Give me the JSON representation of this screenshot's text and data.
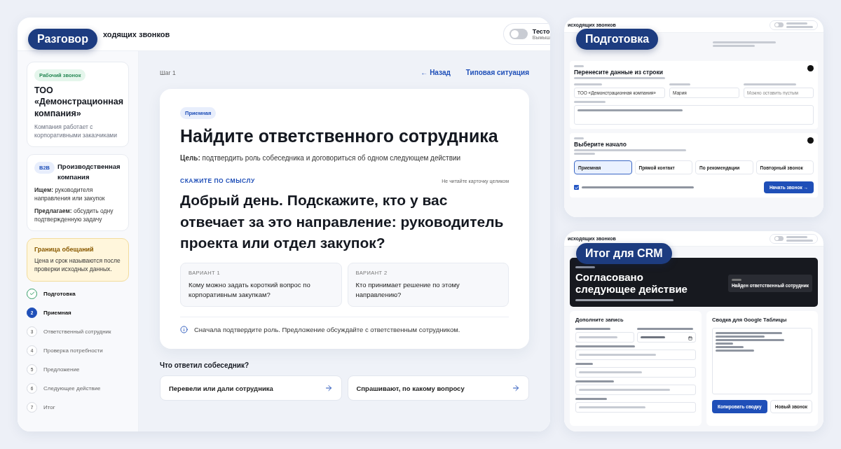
{
  "conversation_window": {
    "label": "Разговор",
    "header": {
      "title": "ходящих звонков",
      "toggle": {
        "on": false,
        "title": "Тесто",
        "subtitle": "Вымыш"
      }
    },
    "sidebar": {
      "company_card": {
        "tag": "Рабочий звонок",
        "name": "ТОО «Демонстрационная компания»",
        "description": "Компания работает с корпоративными заказчиками"
      },
      "profile_card": {
        "tag": "B2B",
        "title": "Производственная компания",
        "lines": [
          "**Ищем:** руководителя направления или закупок",
          "**Предлагаем:** обсудить одну подтвержденную задачу"
        ]
      },
      "notice": {
        "title": "Граница обещаний",
        "text": "Цена и срок называются после проверки исходных данных."
      },
      "steps": [
        {
          "label": "Подготовка",
          "done": true,
          "selected": false
        },
        {
          "number": "2",
          "label": "Приемная",
          "done": false,
          "selected": true
        },
        {
          "number": "3",
          "label": "Ответственный сотрудник",
          "done": false,
          "selected": false
        },
        {
          "number": "4",
          "label": "Проверка потребности",
          "done": false,
          "selected": false
        },
        {
          "number": "5",
          "label": "Предложение",
          "done": false,
          "selected": false
        },
        {
          "number": "6",
          "label": "Следующее действие",
          "done": false,
          "selected": false
        },
        {
          "number": "7",
          "label": "Итог",
          "done": false,
          "selected": false
        }
      ]
    },
    "main": {
      "step": "Шаг 1",
      "back": "← Назад",
      "situation": "Типовая ситуация",
      "card": {
        "tag": "Приемная",
        "title": "Найдите ответственного сотрудника",
        "goal": "**Цель:** подтвердить роль собеседника и договориться об одном следующем действии",
        "say_label": "СКАЖИТЕ ПО СМЫСЛУ",
        "say_hint": "Не читайте карточку целиком",
        "phrase": "Добрый день. Подскажите, кто у вас отвечает за это направление: руководитель проекта или отдел закупок?",
        "variants": [
          {
            "label": "ВАРИАНТ 1",
            "text": "Кому можно задать короткий вопрос по корпоративным закупкам?"
          },
          {
            "label": "ВАРИАНТ 2",
            "text": "Кто принимает решение по этому направлению?"
          }
        ],
        "note": "Сначала подтвердите роль. Предложение обсуждайте с ответственным сотрудником."
      },
      "answers_title": "Что ответил собеседник?",
      "answers": [
        "Перевели или дали сотрудника",
        "Спрашивают, по какому вопросу"
      ]
    }
  },
  "preparation_window": {
    "label": "Подготовка",
    "header": {
      "title": "исходящих звонков",
      "toggle": {
        "on": false
      }
    },
    "data_step": {
      "title": "Перенесите данные из строки",
      "fields": [
        {
          "value": "ТОО «Демонстрационная компания»"
        },
        {
          "value": "Мария"
        },
        {
          "placeholder": "Можно оставить пустым"
        }
      ]
    },
    "start_step": {
      "title": "Выберите начало",
      "options": [
        {
          "label": "Приемная",
          "selected": true
        },
        {
          "label": "Прямой контакт",
          "selected": false
        },
        {
          "label": "По рекомендации",
          "selected": false
        },
        {
          "label": "Повторный звонок",
          "selected": false
        }
      ]
    },
    "consent": {
      "checked": true
    },
    "start_button": "Начать звонок →"
  },
  "crm_window": {
    "label": "Итог для CRM",
    "header": {
      "title": "исходящих звонков",
      "toggle": {
        "on": false
      }
    },
    "banner": {
      "title": "Согласовано следующее действие",
      "status": "Найден ответственный сотрудник"
    },
    "record": {
      "title": "Дополните запись",
      "fields": [
        {
          "kind": "text"
        },
        {
          "kind": "date"
        }
      ]
    },
    "summary": {
      "title": "Сводка для Google Таблицы",
      "copy_button": "Копировать сводку",
      "new_button": "Новый звонок"
    }
  }
}
